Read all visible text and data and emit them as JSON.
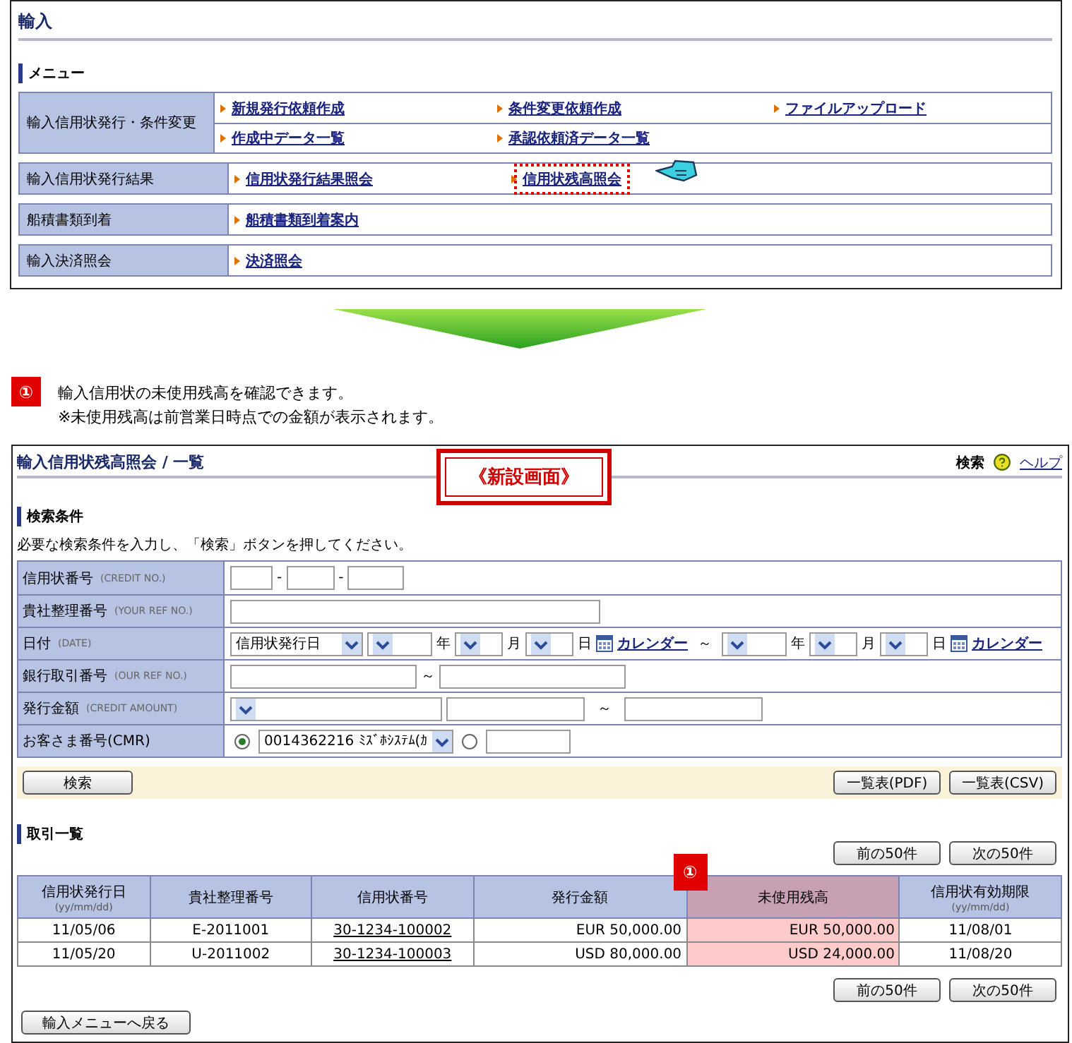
{
  "import_menu": {
    "title": "輸入",
    "section": "メニュー",
    "groups": [
      {
        "label": "輸入信用状発行・条件変更",
        "lines": [
          [
            {
              "label": "新規発行依頼作成",
              "highlighted": false
            },
            {
              "label": "条件変更依頼作成",
              "highlighted": false
            },
            {
              "label": "ファイルアップロード",
              "highlighted": false
            }
          ],
          [
            {
              "label": "作成中データ一覧",
              "highlighted": false
            },
            {
              "label": "承認依頼済データ一覧",
              "highlighted": false
            }
          ]
        ]
      },
      {
        "label": "輸入信用状発行結果",
        "lines": [
          [
            {
              "label": "信用状発行結果照会",
              "highlighted": false
            },
            {
              "label": "信用状残高照会",
              "highlighted": true
            }
          ]
        ]
      },
      {
        "label": "船積書類到着",
        "lines": [
          [
            {
              "label": "船積書類到着案内",
              "highlighted": false
            }
          ]
        ]
      },
      {
        "label": "輸入決済照会",
        "lines": [
          [
            {
              "label": "決済照会",
              "highlighted": false
            }
          ]
        ]
      }
    ]
  },
  "note": {
    "badge": "①",
    "lines": [
      "輸入信用状の未使用残高を確認できます。",
      "※未使用残高は前営業日時点での金額が表示されます。"
    ]
  },
  "screen": {
    "title": "輸入信用状残高照会 / 一覧",
    "stamp": "《新設画面》",
    "search_label": "検索",
    "help_link": "ヘルプ",
    "criteria": {
      "heading": "検索条件",
      "instruction": "必要な検索条件を入力し、「検索」ボタンを押してください。",
      "rows": [
        {
          "kind": "credit-no",
          "label": "信用状番号",
          "sublabel": "(CREDIT NO.)",
          "separators": [
            "-",
            "-"
          ]
        },
        {
          "kind": "text",
          "label": "貴社整理番号",
          "sublabel": "(YOUR REF NO.)"
        },
        {
          "kind": "date",
          "label": "日付",
          "sublabel": "(DATE)",
          "date_type": "信用状発行日",
          "ends": [
            {
              "units": [
                "年",
                "月",
                "日"
              ],
              "calendar": "カレンダー"
            },
            {
              "units": [
                "年",
                "月",
                "日"
              ],
              "calendar": "カレンダー"
            }
          ],
          "separator": "～"
        },
        {
          "kind": "range",
          "label": "銀行取引番号",
          "sublabel": "(OUR REF NO.)",
          "separator": "～"
        },
        {
          "kind": "amount",
          "label": "発行金額",
          "sublabel": "(CREDIT AMOUNT)",
          "separator": "～"
        },
        {
          "kind": "cmr",
          "label": "お客さま番号(CMR)",
          "options": [
            {
              "selected": true,
              "value": "0014362216 ﾐｽﾞﾎｼｽﾃﾑ(ｶ"
            },
            {
              "selected": false
            }
          ]
        }
      ]
    },
    "search_button": "検索",
    "export_buttons": [
      "一覧表(PDF)",
      "一覧表(CSV)"
    ],
    "results": {
      "heading": "取引一覧",
      "pager_top": [
        "前の50件",
        "次の50件"
      ],
      "columns": [
        {
          "label": "信用状発行日",
          "sublabel": "(yy/mm/dd)",
          "kind": "text",
          "highlighted": false
        },
        {
          "label": "貴社整理番号",
          "kind": "text",
          "highlighted": false
        },
        {
          "label": "信用状番号",
          "kind": "link",
          "highlighted": false
        },
        {
          "label": "発行金額",
          "kind": "amount",
          "highlighted": false
        },
        {
          "label": "未使用残高",
          "kind": "amount",
          "highlighted": true,
          "badge": "①"
        },
        {
          "label": "信用状有効期限",
          "sublabel": "(yy/mm/dd)",
          "kind": "text",
          "highlighted": false
        }
      ],
      "rows": [
        [
          "11/05/06",
          "E-2011001",
          "30-1234-100002",
          "EUR 50,000.00",
          "EUR 50,000.00",
          "11/08/01"
        ],
        [
          "11/05/20",
          "U-2011002",
          "30-1234-100003",
          "USD 80,000.00",
          "USD 24,000.00",
          "11/08/20"
        ]
      ],
      "pager_bottom": [
        "前の50件",
        "次の50件"
      ]
    },
    "back_button": "輸入メニューへ戻る"
  }
}
